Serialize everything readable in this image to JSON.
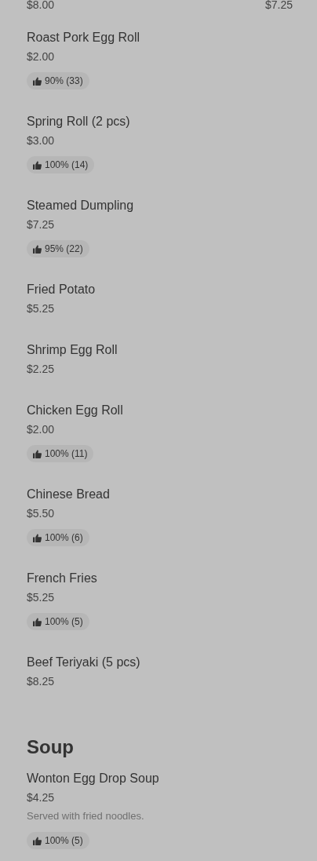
{
  "top_prices": [
    "$8.00",
    "$7.25"
  ],
  "items": [
    {
      "name": "Roast Pork Egg Roll",
      "price": "$2.00",
      "rating": "90% (33)"
    },
    {
      "name": "Spring Roll (2 pcs)",
      "price": "$3.00",
      "rating": "100% (14)"
    },
    {
      "name": "Steamed Dumpling",
      "price": "$7.25",
      "rating": "95% (22)"
    },
    {
      "name": "Fried Potato",
      "price": "$5.25"
    },
    {
      "name": "Shrimp Egg Roll",
      "price": "$2.25"
    },
    {
      "name": "Chicken Egg Roll",
      "price": "$2.00",
      "rating": "100% (11)"
    },
    {
      "name": "Chinese Bread",
      "price": "$5.50",
      "rating": "100% (6)"
    },
    {
      "name": "French Fries",
      "price": "$5.25",
      "rating": "100% (5)"
    },
    {
      "name": "Beef Teriyaki (5 pcs)",
      "price": "$8.25"
    }
  ],
  "sections": [
    {
      "title": "Soup",
      "items": [
        {
          "name": "Wonton Egg Drop Soup",
          "price": "$4.25",
          "description": "Served with fried noodles.",
          "rating": "100% (5)"
        }
      ]
    }
  ]
}
